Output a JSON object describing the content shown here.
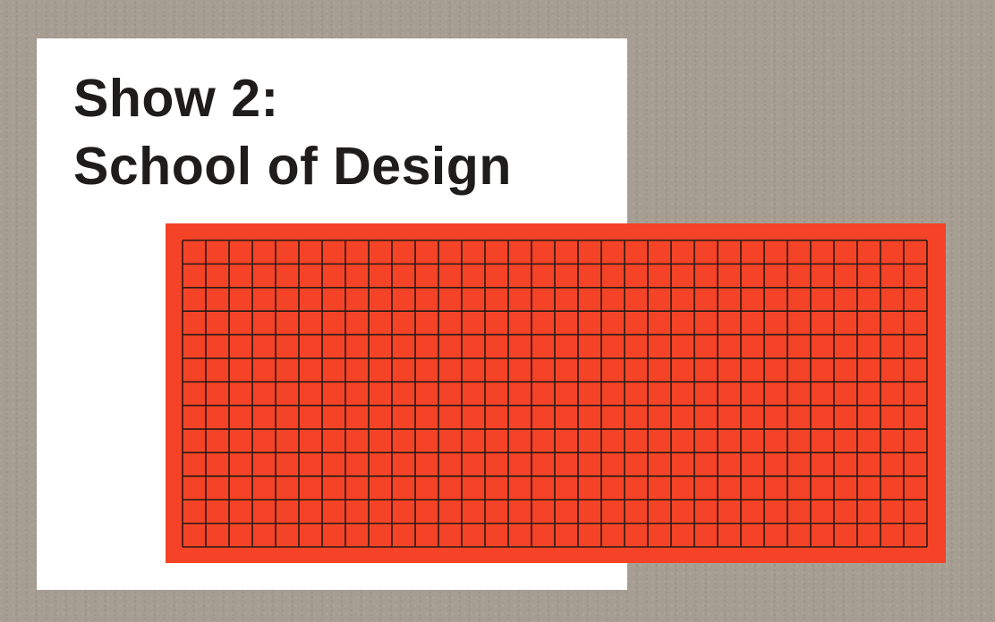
{
  "heading": {
    "line1": "Show 2:",
    "line2": "School of Design"
  },
  "grid": {
    "rows": 13,
    "columns": 32
  },
  "colors": {
    "background": "#a79e93",
    "card": "#ffffff",
    "panel": "#f44326",
    "grid_lines": "#2a1a16",
    "text": "#1f1d1c"
  }
}
